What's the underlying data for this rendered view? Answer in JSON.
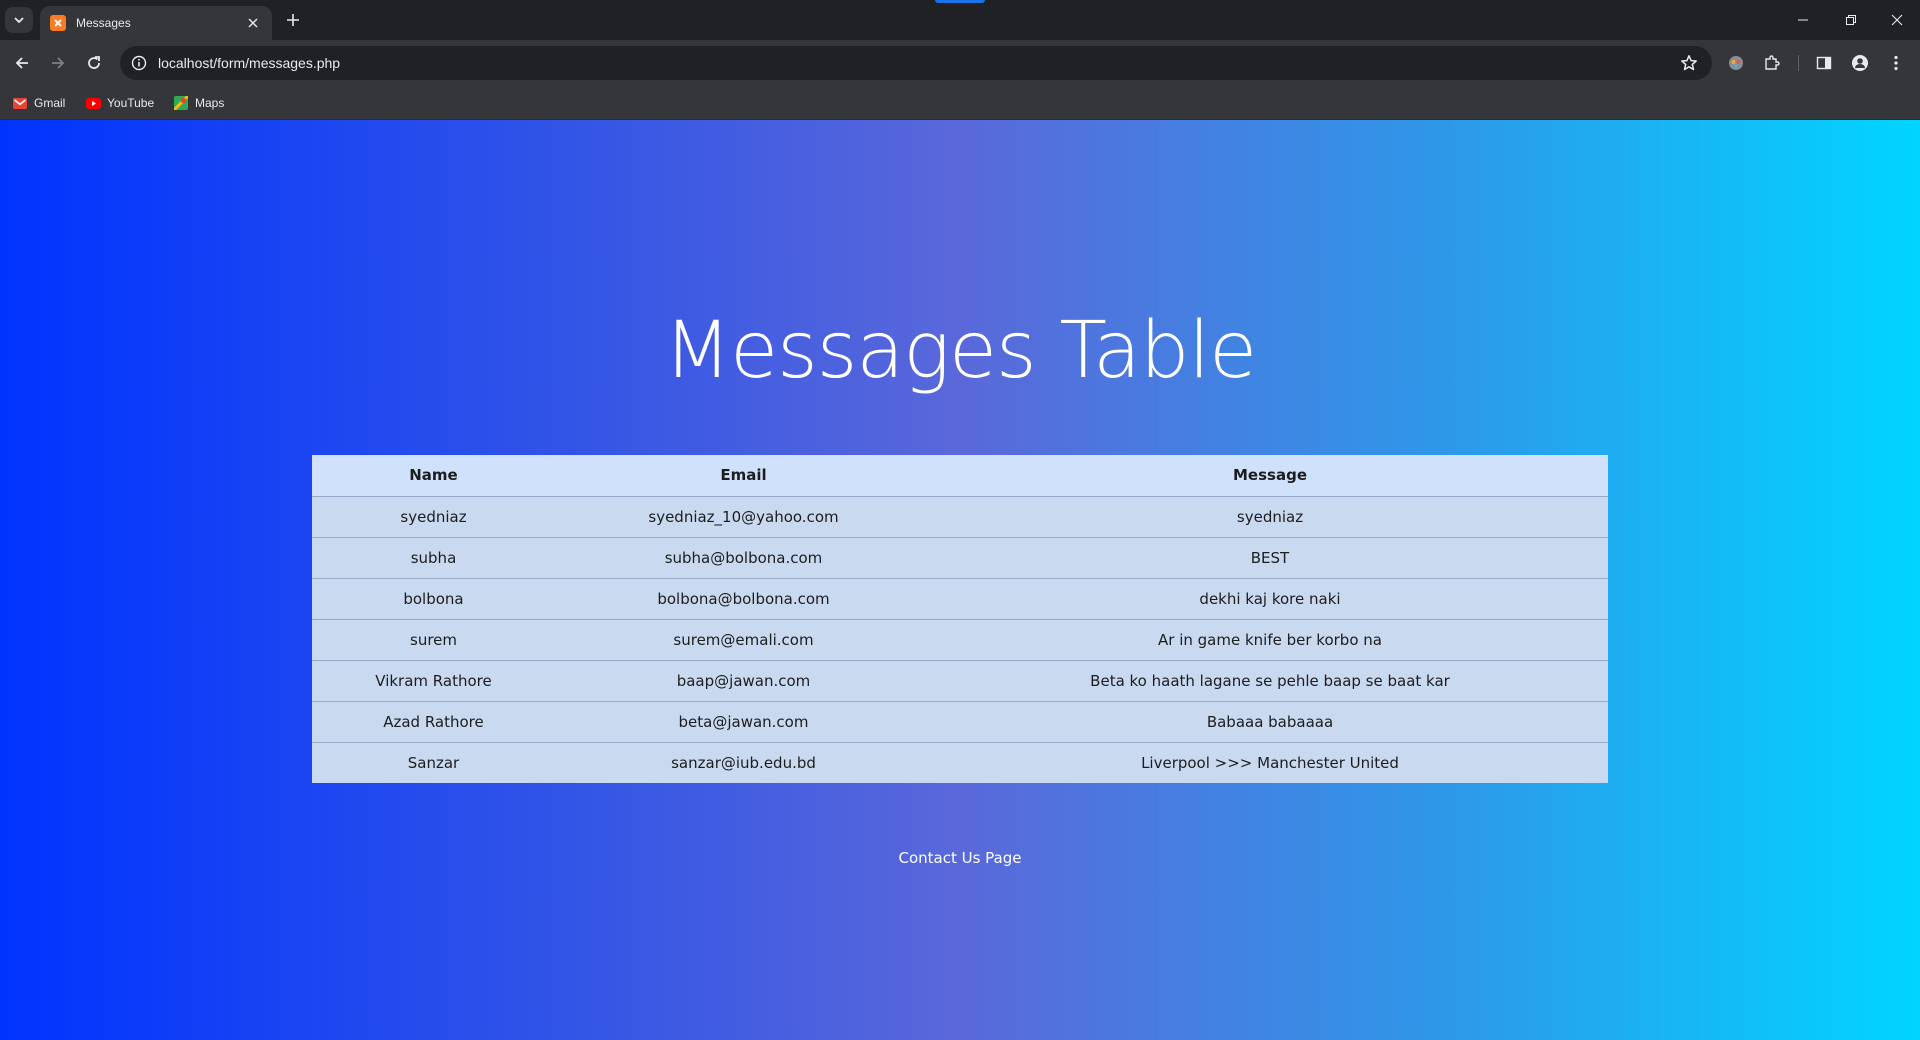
{
  "browser": {
    "tab_title": "Messages",
    "url": "localhost/form/messages.php",
    "bookmarks": [
      {
        "label": "Gmail",
        "icon": "gmail-icon"
      },
      {
        "label": "YouTube",
        "icon": "youtube-icon"
      },
      {
        "label": "Maps",
        "icon": "maps-icon"
      }
    ]
  },
  "page": {
    "title": "Messages Table",
    "table": {
      "headers": {
        "name": "Name",
        "email": "Email",
        "message": "Message"
      },
      "rows": [
        {
          "name": "syedniaz",
          "email": "syedniaz_10@yahoo.com",
          "message": "syedniaz"
        },
        {
          "name": "subha",
          "email": "subha@bolbona.com",
          "message": "BEST"
        },
        {
          "name": "bolbona",
          "email": "bolbona@bolbona.com",
          "message": "dekhi kaj kore naki"
        },
        {
          "name": "surem",
          "email": "surem@emali.com",
          "message": "Ar in game knife ber korbo na"
        },
        {
          "name": "Vikram Rathore",
          "email": "baap@jawan.com",
          "message": "Beta ko haath lagane se pehle baap se baat kar"
        },
        {
          "name": "Azad Rathore",
          "email": "beta@jawan.com",
          "message": "Babaaa babaaaa"
        },
        {
          "name": "Sanzar",
          "email": "sanzar@iub.edu.bd",
          "message": "Liverpool >>> Manchester United"
        }
      ]
    },
    "contact_link": "Contact Us Page"
  },
  "colors": {
    "gradient_left": "#0033ff",
    "gradient_mid": "#5a68da",
    "gradient_right": "#00d5ff",
    "table_header_bg": "#d0e2fb",
    "table_row_bg": "#c9d9f0"
  }
}
